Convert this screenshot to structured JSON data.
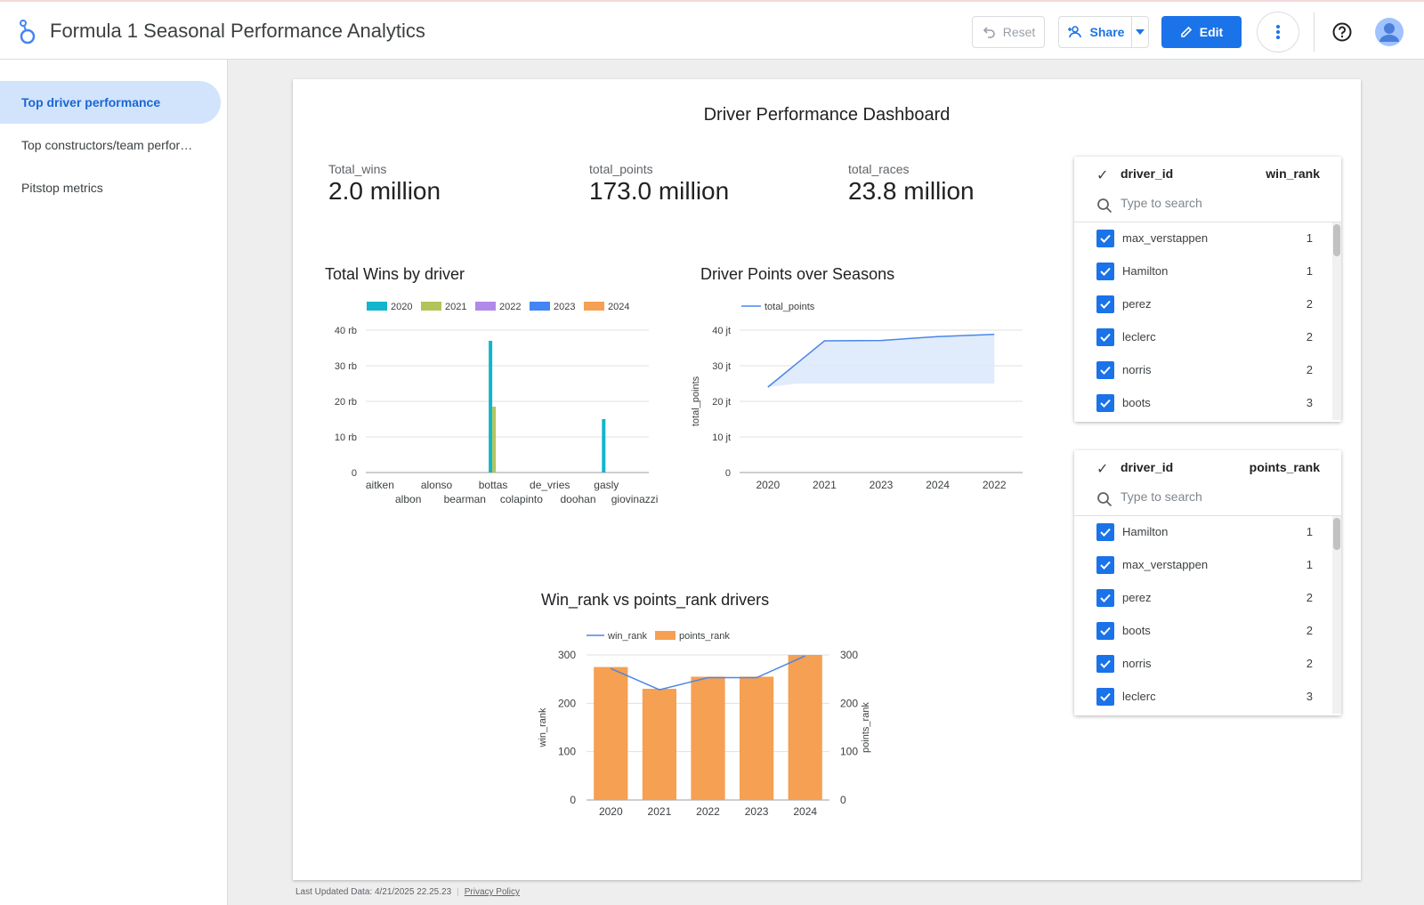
{
  "app": {
    "title": "Formula 1 Seasonal Performance Analytics",
    "reset_label": "Reset",
    "share_label": "Share",
    "edit_label": "Edit",
    "accent": "#1a73e8"
  },
  "sidebar": {
    "items": [
      {
        "label": "Top driver performance",
        "active": true
      },
      {
        "label": "Top constructors/team performance",
        "active": false
      },
      {
        "label": "Pitstop metrics",
        "active": false
      }
    ]
  },
  "dashboard": {
    "title": "Driver Performance Dashboard",
    "kpis": [
      {
        "label": "Total_wins",
        "value": "2.0 million"
      },
      {
        "label": "total_points",
        "value": "173.0 million"
      },
      {
        "label": "total_races",
        "value": "23.8 million"
      }
    ]
  },
  "chart_data": [
    {
      "type": "bar",
      "title": "Total Wins by driver",
      "categories": [
        "aitken",
        "albon",
        "alonso",
        "bearman",
        "bottas",
        "colapinto",
        "de_vries",
        "doohan",
        "gasly",
        "giovinazzi"
      ],
      "series": [
        {
          "name": "2020",
          "color": "#12b5cb",
          "values": [
            0,
            0,
            0,
            0,
            37000,
            0,
            0,
            0,
            15000,
            0
          ]
        },
        {
          "name": "2021",
          "color": "#b4c45a",
          "values": [
            0,
            0,
            0,
            0,
            18500,
            0,
            0,
            0,
            0,
            0
          ]
        },
        {
          "name": "2022",
          "color": "#b189e8",
          "values": [
            0,
            0,
            0,
            0,
            0,
            0,
            0,
            0,
            0,
            0
          ]
        },
        {
          "name": "2023",
          "color": "#4285f4",
          "values": [
            0,
            0,
            0,
            0,
            0,
            0,
            0,
            0,
            0,
            0
          ]
        },
        {
          "name": "2024",
          "color": "#f5a052",
          "values": [
            0,
            0,
            0,
            0,
            0,
            0,
            0,
            0,
            0,
            0
          ]
        }
      ],
      "ylim": [
        0,
        40000
      ],
      "yticks": [
        {
          "v": 0,
          "label": "0"
        },
        {
          "v": 10000,
          "label": "10 rb"
        },
        {
          "v": 20000,
          "label": "20 rb"
        },
        {
          "v": 30000,
          "label": "30 rb"
        },
        {
          "v": 40000,
          "label": "40 rb"
        }
      ],
      "grid": true,
      "legend": "top"
    },
    {
      "type": "area",
      "title": "Driver Points over Seasons",
      "categories": [
        "2020",
        "2021",
        "2023",
        "2024",
        "2022"
      ],
      "series": [
        {
          "name": "total_points",
          "color": "#4a86e8",
          "values": [
            24000000,
            37000000,
            37100000,
            38200000,
            38800000
          ]
        }
      ],
      "ylabel": "total_points",
      "ylim": [
        0,
        40000000
      ],
      "yticks": [
        {
          "v": 0,
          "label": "0"
        },
        {
          "v": 10000000,
          "label": "10 jt"
        },
        {
          "v": 20000000,
          "label": "20 jt"
        },
        {
          "v": 30000000,
          "label": "30 jt"
        },
        {
          "v": 40000000,
          "label": "40 jt"
        }
      ],
      "grid": true,
      "legend": "top"
    },
    {
      "type": "bar",
      "title": "Win_rank vs points_rank drivers",
      "categories": [
        "2020",
        "2021",
        "2022",
        "2023",
        "2024"
      ],
      "series": [
        {
          "name": "win_rank",
          "type": "line",
          "axis": "left",
          "color": "#4a86e8",
          "values": [
            272,
            228,
            253,
            253,
            298
          ]
        },
        {
          "name": "points_rank",
          "type": "bar",
          "axis": "right",
          "color": "#f5a052",
          "values": [
            275,
            230,
            255,
            255,
            300
          ]
        }
      ],
      "ylabel": "win_rank",
      "y2label": "points_rank",
      "ylim": [
        0,
        300
      ],
      "yticks": [
        0,
        100,
        200,
        300
      ],
      "grid": true,
      "legend": "top"
    }
  ],
  "filters": [
    {
      "col1": "driver_id",
      "col2": "win_rank",
      "search_placeholder": "Type to search",
      "rows": [
        {
          "name": "max_verstappen",
          "rank": "1"
        },
        {
          "name": "Hamilton",
          "rank": "1"
        },
        {
          "name": "perez",
          "rank": "2"
        },
        {
          "name": "leclerc",
          "rank": "2"
        },
        {
          "name": "norris",
          "rank": "2"
        },
        {
          "name": "boots",
          "rank": "3"
        }
      ]
    },
    {
      "col1": "driver_id",
      "col2": "points_rank",
      "search_placeholder": "Type to search",
      "rows": [
        {
          "name": "Hamilton",
          "rank": "1"
        },
        {
          "name": "max_verstappen",
          "rank": "1"
        },
        {
          "name": "perez",
          "rank": "2"
        },
        {
          "name": "boots",
          "rank": "2"
        },
        {
          "name": "norris",
          "rank": "2"
        },
        {
          "name": "leclerc",
          "rank": "3"
        }
      ]
    }
  ],
  "footer": {
    "updated": "Last Updated Data: 4/21/2025 22.25.23",
    "privacy": "Privacy Policy"
  }
}
